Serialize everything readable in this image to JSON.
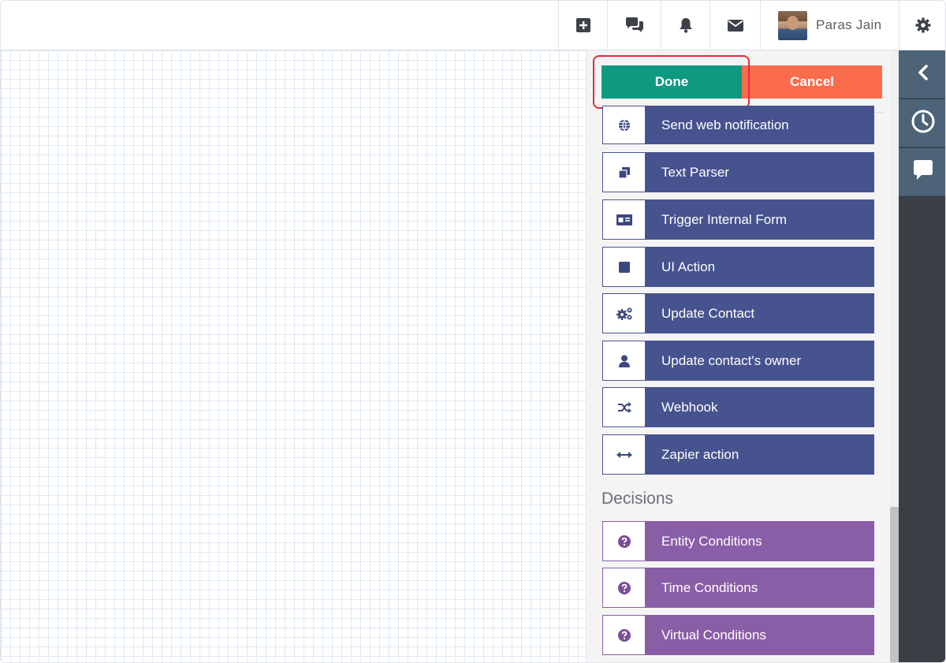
{
  "topbar": {
    "icons": [
      "add-square-icon",
      "chat-bubbles-icon",
      "bell-icon",
      "envelope-icon",
      "gear-icon"
    ],
    "user_name": "Paras Jain"
  },
  "panel": {
    "done_label": "Done",
    "cancel_label": "Cancel",
    "action_items": [
      {
        "label": "Send web notification",
        "icon": "globe-icon"
      },
      {
        "label": "Text Parser",
        "icon": "copy-icon"
      },
      {
        "label": "Trigger Internal Form",
        "icon": "id-card-icon"
      },
      {
        "label": "UI Action",
        "icon": "square-icon"
      },
      {
        "label": "Update Contact",
        "icon": "cogs-icon"
      },
      {
        "label": "Update contact's owner",
        "icon": "user-icon"
      },
      {
        "label": "Webhook",
        "icon": "shuffle-icon"
      },
      {
        "label": "Zapier action",
        "icon": "arrows-horizontal-icon"
      }
    ],
    "decisions_title": "Decisions",
    "decision_items": [
      {
        "label": "Entity Conditions",
        "icon": "question-circle-icon"
      },
      {
        "label": "Time Conditions",
        "icon": "question-circle-icon"
      },
      {
        "label": "Virtual Conditions",
        "icon": "question-circle-icon"
      }
    ]
  },
  "rail": {
    "icons": [
      "chevron-left-icon",
      "clock-icon",
      "comment-icon"
    ]
  },
  "colors": {
    "done": "#0d9a80",
    "cancel": "#fb6c4d",
    "action_item": "#46538e",
    "decision_item": "#8a5ea6",
    "highlight": "#e22b3a"
  }
}
